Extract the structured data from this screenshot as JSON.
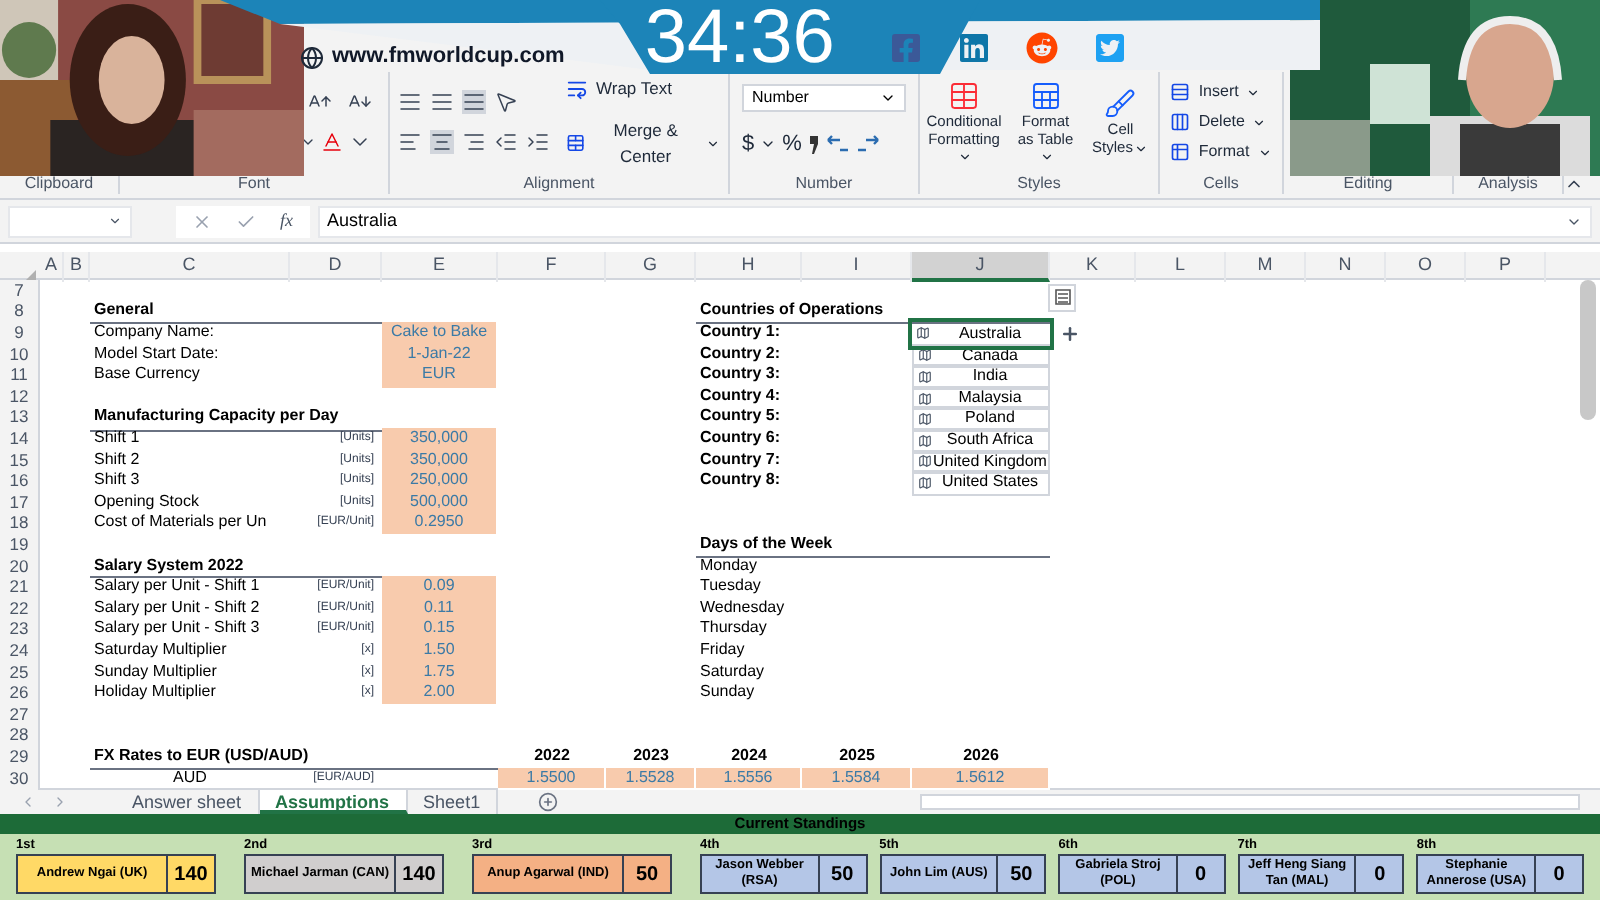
{
  "banner": {
    "website": "www.fmworldcup.com",
    "timer": "34:36"
  },
  "ribbon": {
    "clipboard": {
      "label": "Clipboard"
    },
    "font": {
      "label": "Font"
    },
    "alignment": {
      "label": "Alignment",
      "wrap_text": "Wrap Text",
      "merge": "Merge & Center"
    },
    "number": {
      "label": "Number",
      "format": "Number",
      "currency": "$",
      "percent": "%"
    },
    "styles": {
      "label": "Styles",
      "buttons": [
        "Conditional Formatting",
        "Format as Table",
        "Cell Styles"
      ]
    },
    "cells": {
      "label": "Cells",
      "buttons": [
        "Insert",
        "Delete",
        "Format"
      ]
    },
    "editing": {
      "label": "Editing"
    },
    "analysis": {
      "label": "Analysis"
    }
  },
  "formula_bar": {
    "function_label": "fx",
    "value": "Australia"
  },
  "columns": [
    "A",
    "B",
    "C",
    "D",
    "E",
    "F",
    "G",
    "H",
    "I",
    "J",
    "K",
    "L",
    "M",
    "N",
    "O",
    "P"
  ],
  "rows": [
    {
      "number": "7",
      "cells": {}
    },
    {
      "number": "8",
      "cells": {
        "C": {
          "text": "General",
          "kind": "heading"
        },
        "H": {
          "text": "Countries of Operations",
          "kind": "heading"
        }
      }
    },
    {
      "number": "9",
      "cells": {
        "C": {
          "text": "Company Name:",
          "kind": "label"
        },
        "E": {
          "text": "Cake to Bake",
          "kind": "input"
        },
        "H": {
          "text": "Country 1:",
          "kind": "country-label"
        },
        "J": {
          "text": "Australia",
          "kind": "country",
          "selected": true
        }
      }
    },
    {
      "number": "10",
      "cells": {
        "C": {
          "text": "Model Start Date:",
          "kind": "label"
        },
        "E": {
          "text": "1-Jan-22",
          "kind": "input"
        },
        "H": {
          "text": "Country 2:",
          "kind": "country-label"
        },
        "J": {
          "text": "Canada",
          "kind": "country",
          "selected": false
        }
      }
    },
    {
      "number": "11",
      "cells": {
        "C": {
          "text": "Base Currency",
          "kind": "label"
        },
        "E": {
          "text": "EUR",
          "kind": "input"
        },
        "H": {
          "text": "Country 3:",
          "kind": "country-label"
        },
        "J": {
          "text": "India",
          "kind": "country",
          "selected": false
        }
      }
    },
    {
      "number": "12",
      "cells": {
        "H": {
          "text": "Country 4:",
          "kind": "country-label"
        },
        "J": {
          "text": "Malaysia",
          "kind": "country",
          "selected": false
        }
      }
    },
    {
      "number": "13",
      "cells": {
        "C": {
          "text": "Manufacturing Capacity per Day",
          "kind": "heading"
        },
        "H": {
          "text": "Country 5:",
          "kind": "country-label"
        },
        "J": {
          "text": "Poland",
          "kind": "country",
          "selected": false
        }
      }
    },
    {
      "number": "14",
      "cells": {
        "C": {
          "text": "Shift 1",
          "kind": "label"
        },
        "D": {
          "text": "[Units]",
          "kind": "unit"
        },
        "E": {
          "text": "350,000",
          "kind": "input"
        },
        "H": {
          "text": "Country 6:",
          "kind": "country-label"
        },
        "J": {
          "text": "South Africa",
          "kind": "country",
          "selected": false
        }
      }
    },
    {
      "number": "15",
      "cells": {
        "C": {
          "text": "Shift 2",
          "kind": "label"
        },
        "D": {
          "text": "[Units]",
          "kind": "unit"
        },
        "E": {
          "text": "350,000",
          "kind": "input"
        },
        "H": {
          "text": "Country 7:",
          "kind": "country-label"
        },
        "J": {
          "text": "United Kingdom",
          "kind": "country",
          "selected": false
        }
      }
    },
    {
      "number": "16",
      "cells": {
        "C": {
          "text": "Shift 3",
          "kind": "label"
        },
        "D": {
          "text": "[Units]",
          "kind": "unit"
        },
        "E": {
          "text": "250,000",
          "kind": "input"
        },
        "H": {
          "text": "Country 8:",
          "kind": "country-label"
        },
        "J": {
          "text": "United States",
          "kind": "country",
          "selected": false
        }
      }
    },
    {
      "number": "17",
      "cells": {
        "C": {
          "text": "Opening Stock",
          "kind": "label"
        },
        "D": {
          "text": "[Units]",
          "kind": "unit"
        },
        "E": {
          "text": "500,000",
          "kind": "input"
        }
      }
    },
    {
      "number": "18",
      "cells": {
        "C": {
          "text": "Cost of Materials per Un",
          "kind": "label"
        },
        "D": {
          "text": "[EUR/Unit]",
          "kind": "unit"
        },
        "E": {
          "text": "0.2950",
          "kind": "input"
        }
      }
    },
    {
      "number": "19",
      "cells": {
        "H": {
          "text": "Days of the Week",
          "kind": "heading"
        }
      }
    },
    {
      "number": "20",
      "cells": {
        "C": {
          "text": "Salary System 2022",
          "kind": "heading"
        },
        "H": {
          "text": "Monday",
          "kind": "day"
        }
      }
    },
    {
      "number": "21",
      "cells": {
        "C": {
          "text": "Salary per Unit - Shift 1",
          "kind": "label"
        },
        "D": {
          "text": "[EUR/Unit]",
          "kind": "unit"
        },
        "E": {
          "text": "0.09",
          "kind": "input"
        },
        "H": {
          "text": "Tuesday",
          "kind": "day"
        }
      }
    },
    {
      "number": "22",
      "cells": {
        "C": {
          "text": "Salary per Unit - Shift 2",
          "kind": "label"
        },
        "D": {
          "text": "[EUR/Unit]",
          "kind": "unit"
        },
        "E": {
          "text": "0.11",
          "kind": "input"
        },
        "H": {
          "text": "Wednesday",
          "kind": "day"
        }
      }
    },
    {
      "number": "23",
      "cells": {
        "C": {
          "text": "Salary per Unit - Shift 3",
          "kind": "label"
        },
        "D": {
          "text": "[EUR/Unit]",
          "kind": "unit"
        },
        "E": {
          "text": "0.15",
          "kind": "input"
        },
        "H": {
          "text": "Thursday",
          "kind": "day"
        }
      }
    },
    {
      "number": "24",
      "cells": {
        "C": {
          "text": "Saturday Multiplier",
          "kind": "label"
        },
        "D": {
          "text": "[x]",
          "kind": "unit"
        },
        "E": {
          "text": "1.50",
          "kind": "input"
        },
        "H": {
          "text": "Friday",
          "kind": "day"
        }
      }
    },
    {
      "number": "25",
      "cells": {
        "C": {
          "text": "Sunday Multiplier",
          "kind": "label"
        },
        "D": {
          "text": "[x]",
          "kind": "unit"
        },
        "E": {
          "text": "1.75",
          "kind": "input"
        },
        "H": {
          "text": "Saturday",
          "kind": "day"
        }
      }
    },
    {
      "number": "26",
      "cells": {
        "C": {
          "text": "Holiday Multiplier",
          "kind": "label"
        },
        "D": {
          "text": "[x]",
          "kind": "unit"
        },
        "E": {
          "text": "2.00",
          "kind": "input"
        },
        "H": {
          "text": "Sunday",
          "kind": "day"
        }
      }
    },
    {
      "number": "27",
      "cells": {}
    },
    {
      "number": "28",
      "cells": {}
    },
    {
      "number": "29",
      "cells": {
        "C": {
          "text": "FX Rates to EUR (USD/AUD)",
          "kind": "heading"
        },
        "F": {
          "text": "2022",
          "kind": "year"
        },
        "G": {
          "text": "2023",
          "kind": "year"
        },
        "H": {
          "text": "2024",
          "kind": "year"
        },
        "I": {
          "text": "2025",
          "kind": "year"
        },
        "J": {
          "text": "2026",
          "kind": "year"
        }
      }
    },
    {
      "number": "30",
      "cells": {
        "C": {
          "text": "AUD",
          "kind": "currency"
        },
        "D": {
          "text": "[EUR/AUD]",
          "kind": "unit"
        },
        "F": {
          "text": "1.5500",
          "kind": "input"
        },
        "G": {
          "text": "1.5528",
          "kind": "input"
        },
        "H": {
          "text": "1.5556",
          "kind": "input"
        },
        "I": {
          "text": "1.5584",
          "kind": "input"
        },
        "J": {
          "text": "1.5612",
          "kind": "input"
        }
      }
    }
  ],
  "sheet_tabs": [
    {
      "label": "Answer sheet",
      "selected": false
    },
    {
      "label": "Assumptions",
      "selected": true
    },
    {
      "label": "Sheet1",
      "selected": false
    }
  ],
  "standings": {
    "title": "Current Standings",
    "entries": [
      {
        "place": "1st",
        "name": "Andrew Ngai (UK)",
        "score": "140",
        "color": "#ffd966"
      },
      {
        "place": "2nd",
        "name": "Michael Jarman (CAN)",
        "score": "140",
        "color": "#d0cece"
      },
      {
        "place": "3rd",
        "name": "Anup Agarwal (IND)",
        "score": "50",
        "color": "#f4b084"
      },
      {
        "place": "4th",
        "name": "Jason Webber (RSA)",
        "score": "50",
        "color": "#b4c6e7"
      },
      {
        "place": "5th",
        "name": "John Lim (AUS)",
        "score": "50",
        "color": "#b4c6e7"
      },
      {
        "place": "6th",
        "name": "Gabriela Stroj (POL)",
        "score": "0",
        "color": "#b4c6e7"
      },
      {
        "place": "7th",
        "name": "Jeff Heng Siang Tan (MAL)",
        "score": "0",
        "color": "#b4c6e7"
      },
      {
        "place": "8th",
        "name": "Stephanie Annerose (USA)",
        "score": "0",
        "color": "#b4c6e7"
      }
    ]
  }
}
